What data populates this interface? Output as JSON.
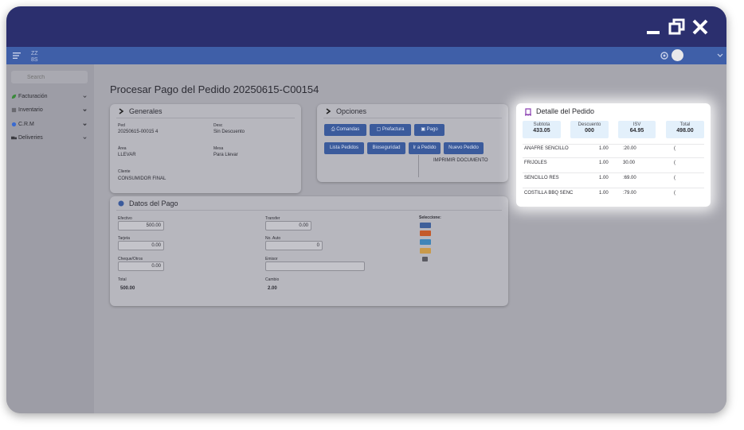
{
  "window": {
    "controls": [
      "minimize-icon",
      "restore-icon",
      "close-icon"
    ]
  },
  "appbar": {
    "logo_icon": "zelvo-logo",
    "menu_icon": "hamburger-icon",
    "settings_icon": "gear-icon"
  },
  "sidebar": {
    "search_placeholder": "Search",
    "items": [
      {
        "label": "Facturación",
        "icon": "leaf-icon",
        "color": "#3a8a3a"
      },
      {
        "label": "Inventario",
        "icon": "box-icon",
        "color": "#6a6a70"
      },
      {
        "label": "C.R.M",
        "icon": "globe-icon",
        "color": "#3a6ad0"
      },
      {
        "label": "Deliveries",
        "icon": "truck-icon",
        "color": "#3a3a40"
      }
    ]
  },
  "page": {
    "title": "Procesar Pago del Pedido 20250615-C00154"
  },
  "generales": {
    "title": "Generales",
    "ped_label": "Ped",
    "ped_value": "20250615-00015 4",
    "desc_label": "Desc",
    "desc_value": "Sin Descuento",
    "area_label": "Área",
    "area_value": "LLEVAR",
    "mesa_label": "Mesa",
    "mesa_value": "Para Llevar",
    "cliente_label": "Cliente",
    "cliente_value": "CONSUMIDOR FINAL"
  },
  "opciones": {
    "title": "Opciones",
    "buttons": {
      "comandas": "Comandas",
      "prefactura": "Prefactura",
      "pago": "Pago",
      "lista_pedidos": "Lista Pedidos",
      "bioseguridad": "Bioseguridad",
      "ir_pedido": "Ir a Pedido",
      "nuevo_pedido": "Nuevo Pedido"
    },
    "imprimir": "IMPRIMIR DOCUMENTO"
  },
  "pago": {
    "title": "Datos del Pago",
    "efectivo_label": "Efectivo",
    "efectivo_value": "500.00",
    "transfer_label": "Transfer",
    "transfer_value": "0.00",
    "tarjeta_label": "Tarjeta",
    "tarjeta_value": "0.00",
    "noauto_label": "No. Auto",
    "noauto_value": "0",
    "cheque_label": "Cheque/Otros",
    "cheque_value": "0.00",
    "emisor_label": "Emisor",
    "emisor_value": "",
    "total_label": "Total",
    "total_value": "500.00",
    "cambio_label": "Cambio",
    "cambio_value": "2.00",
    "seleccione": "Seleccione:",
    "payment_icons": [
      "visa-card-icon",
      "mastercard-icon",
      "amex-card-icon",
      "discover-card-icon",
      "generic-card-icon"
    ]
  },
  "detalle": {
    "title": "Detalle del Pedido",
    "icon": "receipt-icon",
    "accent": "#8a3fb0",
    "summary": [
      {
        "label": "Subtota",
        "value": "433.05"
      },
      {
        "label": "Descuento",
        "value": "000"
      },
      {
        "label": "ISV",
        "value": "64.95"
      },
      {
        "label": "Total",
        "value": "498.00"
      }
    ],
    "items": [
      {
        "name": "ANAFRE SENCILLO",
        "qty": "1.00",
        "price": ":20.00",
        "action": "("
      },
      {
        "name": "FRIJOLES",
        "qty": "1.00",
        "price": "30.00",
        "action": "("
      },
      {
        "name": "SENCILLO RES",
        "qty": "1.00",
        "price": ":69.00",
        "action": "("
      },
      {
        "name": "COSTILLA BBQ SENC",
        "qty": "1.00",
        "price": ":79.00",
        "action": "("
      }
    ]
  }
}
